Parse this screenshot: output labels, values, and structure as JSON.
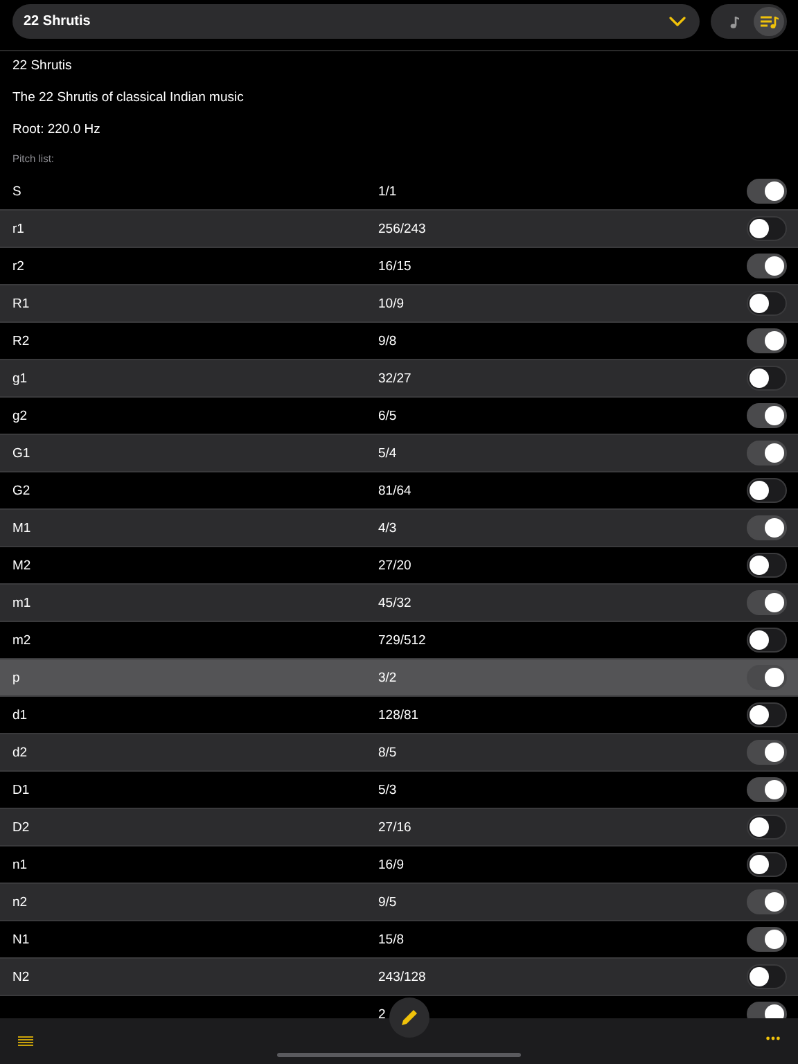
{
  "selector": {
    "value": "22 Shrutis"
  },
  "view_toggle": [
    {
      "kind": "note",
      "selected": false
    },
    {
      "kind": "list",
      "selected": true
    }
  ],
  "info": {
    "name": "22 Shrutis",
    "description": "The 22 Shrutis of classical Indian music",
    "root": "Root: 220.0 Hz",
    "list_label": "Pitch list:"
  },
  "pitches": [
    {
      "name": "S",
      "ratio": "1/1",
      "on": true,
      "selected": false
    },
    {
      "name": "r1",
      "ratio": "256/243",
      "on": false,
      "selected": false
    },
    {
      "name": "r2",
      "ratio": "16/15",
      "on": true,
      "selected": false
    },
    {
      "name": "R1",
      "ratio": "10/9",
      "on": false,
      "selected": false
    },
    {
      "name": "R2",
      "ratio": "9/8",
      "on": true,
      "selected": false
    },
    {
      "name": "g1",
      "ratio": "32/27",
      "on": false,
      "selected": false
    },
    {
      "name": "g2",
      "ratio": "6/5",
      "on": true,
      "selected": false
    },
    {
      "name": "G1",
      "ratio": "5/4",
      "on": true,
      "selected": false
    },
    {
      "name": "G2",
      "ratio": "81/64",
      "on": false,
      "selected": false
    },
    {
      "name": "M1",
      "ratio": "4/3",
      "on": true,
      "selected": false
    },
    {
      "name": "M2",
      "ratio": "27/20",
      "on": false,
      "selected": false
    },
    {
      "name": "m1",
      "ratio": "45/32",
      "on": true,
      "selected": false
    },
    {
      "name": "m2",
      "ratio": "729/512",
      "on": false,
      "selected": false
    },
    {
      "name": "p",
      "ratio": "3/2",
      "on": true,
      "selected": true
    },
    {
      "name": "d1",
      "ratio": "128/81",
      "on": false,
      "selected": false
    },
    {
      "name": "d2",
      "ratio": "8/5",
      "on": true,
      "selected": false
    },
    {
      "name": "D1",
      "ratio": "5/3",
      "on": true,
      "selected": false
    },
    {
      "name": "D2",
      "ratio": "27/16",
      "on": false,
      "selected": false
    },
    {
      "name": "n1",
      "ratio": "16/9",
      "on": false,
      "selected": false
    },
    {
      "name": "n2",
      "ratio": "9/5",
      "on": true,
      "selected": false
    },
    {
      "name": "N1",
      "ratio": "15/8",
      "on": true,
      "selected": false
    },
    {
      "name": "N2",
      "ratio": "243/128",
      "on": false,
      "selected": false
    },
    {
      "ratio": "2",
      "on": true,
      "selected": false
    }
  ]
}
